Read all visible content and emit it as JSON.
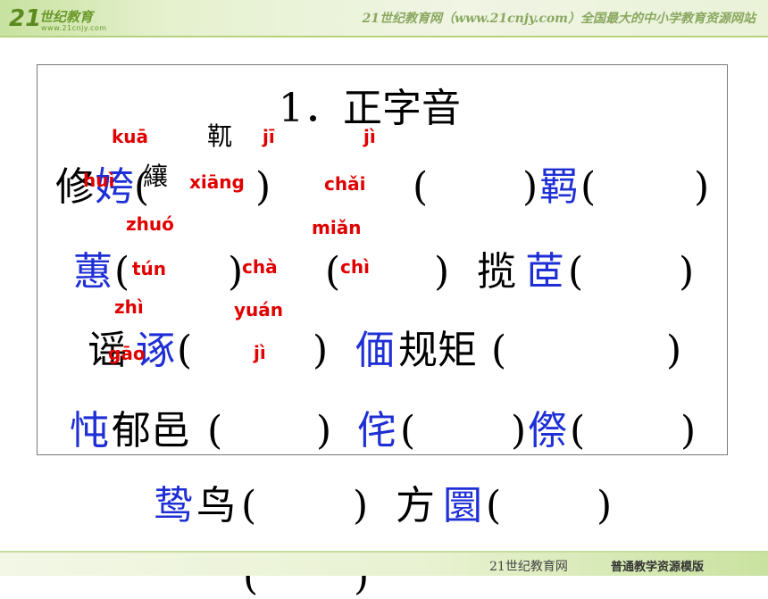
{
  "banner": {
    "logo_mark": "21",
    "logo_name": "世纪教育",
    "logo_url": "www.21cnjy.com",
    "text": "21世纪教育网（www.21cnjy.com）全国最大的中小学教育资源网站"
  },
  "title": "1．正字音",
  "rows": {
    "r1": {
      "a": "修",
      "b": "姱",
      "c": "(",
      "d": "纕",
      "e": ")",
      "f": "(",
      "g": ")",
      "h": "羁",
      "i": "(",
      "j": ")"
    },
    "r1_small": "靰",
    "r2": {
      "a": "蕙",
      "b": "(",
      "c": ")",
      "d": "(",
      "e": ")",
      "f": "揽",
      "g": "茝",
      "h": "(",
      "i": ")"
    },
    "r3": {
      "a": "谣",
      "b": "诼",
      "c": "(",
      "d": ")",
      "e": "偭",
      "f": "规矩",
      "g": "(",
      "h": ")"
    },
    "r4": {
      "a": "忳",
      "b": "郁邑",
      "c": "(",
      "d": ")",
      "e": "侘",
      "f": "(",
      "g": ")",
      "h": "傺",
      "i": "(",
      "j": ")"
    },
    "r5": {
      "a": "鸷",
      "b": "鸟",
      "c": "(",
      "d": ")",
      "e": "方",
      "f": "圜",
      "g": "(",
      "h": ")"
    },
    "r6": {
      "a": "",
      "b": "",
      "c": "(",
      "d": ")",
      "e": "",
      "f": ""
    }
  },
  "pinyin": {
    "p1": "kuā",
    "p2": "jī",
    "p3": "jì",
    "p4": "huì",
    "p5": "xiāng",
    "p6": "chǎi",
    "p7": "zhuó",
    "p8": "miǎn",
    "p9": "tún",
    "p10": "chà",
    "p11": "chì",
    "p12": "zhì",
    "p13": "yuán",
    "p14": "gāo",
    "p15": "jì"
  },
  "footer": {
    "left": "21世纪教育网",
    "right": "普通教学资源模版"
  },
  "colors": {
    "blue": "#1f2fd6",
    "red": "#e00000",
    "banner_green": "#c8e2a0"
  }
}
